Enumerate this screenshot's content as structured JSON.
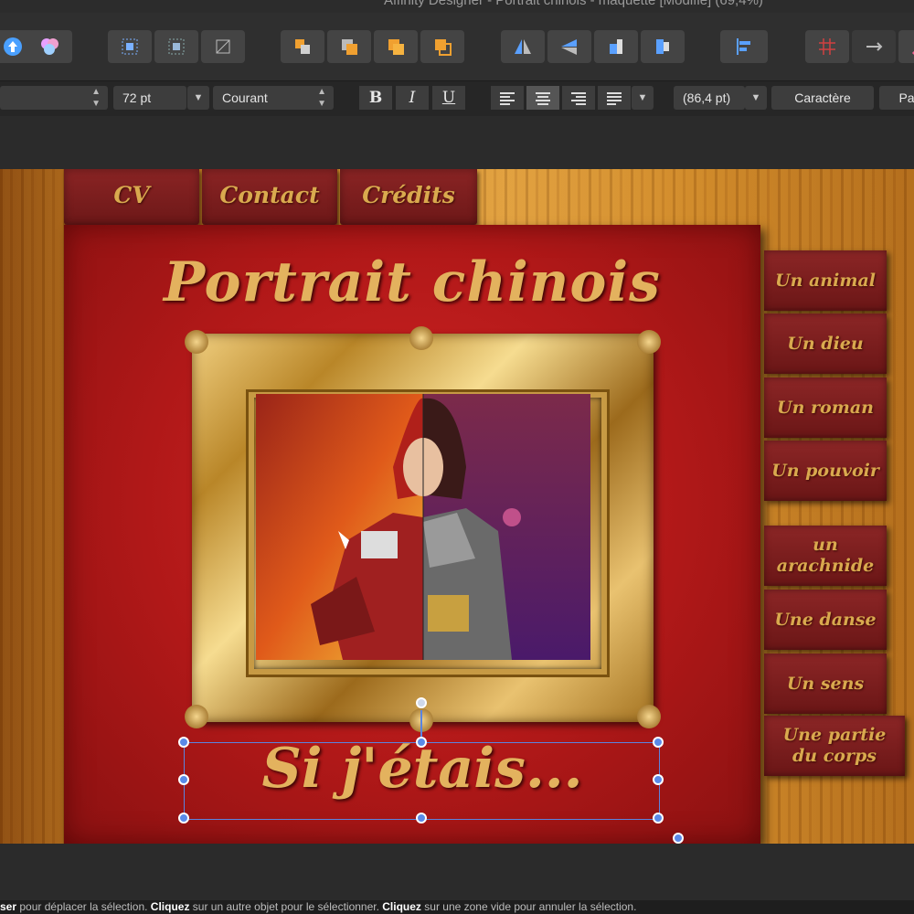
{
  "window": {
    "title": "Affinity Designer - Portrait chinois - maquette [Modifié] (69,4%)"
  },
  "toolbar": {
    "icons": [
      "upload-icon",
      "boolean-icon",
      "align-grid-icon",
      "snap-grid-icon",
      "transform-icon",
      "arrange-back-icon",
      "arrange-backward-icon",
      "arrange-forward-icon",
      "arrange-front-icon",
      "flip-horizontal-icon",
      "flip-vertical-icon",
      "rotate-left-icon",
      "rotate-right-icon",
      "align-left-icon",
      "snapping-icon",
      "distribute-icon",
      "pen-icon"
    ]
  },
  "context": {
    "font_size": "72 pt",
    "font_style": "Courant",
    "bold_label": "B",
    "italic_label": "I",
    "underline_label": "U",
    "line_spacing": "(86,4 pt)",
    "character_button": "Caractère",
    "paragraph_button": "Pa"
  },
  "canvas": {
    "top_tabs": [
      "CV",
      "Contact",
      "Crédits"
    ],
    "heading": "Portrait chinois",
    "subtitle": "Si j'étais...",
    "side_group_1": [
      "Un animal",
      "Un dieu",
      "Un roman",
      "Un pouvoir"
    ],
    "side_group_2": [
      "un arachnide",
      "Une danse",
      "Un sens",
      "Une partie du corps"
    ]
  },
  "status": {
    "part1": "ser",
    "text1": " pour déplacer la sélection. ",
    "bold2": "Cliquez",
    "text2": " sur un autre objet pour le sélectionner. ",
    "bold3": "Cliquez",
    "text3": " sur une zone vide pour annuler la sélection."
  },
  "colors": {
    "selection": "#5a84e0",
    "accent_gold": "#e3b25e",
    "panel_red": "#b01818"
  }
}
